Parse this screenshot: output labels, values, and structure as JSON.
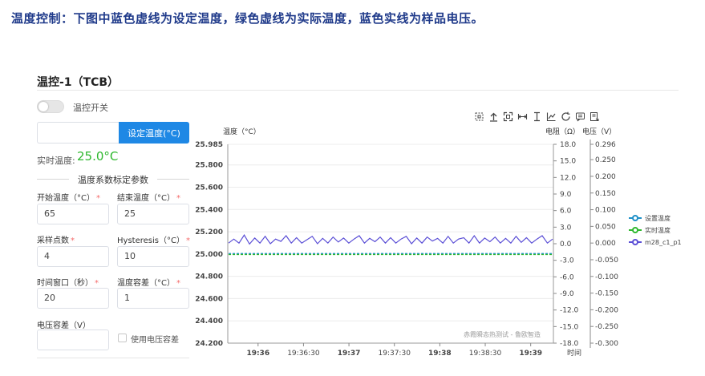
{
  "caption": "温度控制：下图中蓝色虚线为设定温度，绿色虚线为实际温度，蓝色实线为样品电压。",
  "panel": {
    "title": "温控-1（TCB）",
    "switch_label": "温控开关",
    "switch_on": false,
    "setpoint": {
      "value": "",
      "button_label": "设定温度(°C)"
    },
    "realtime": {
      "label": "实时温度:",
      "value": "25.0°C",
      "color": "#2eb82e"
    },
    "section_title": "温度系数标定参数",
    "fields": [
      {
        "key": "start_temp",
        "label": "开始温度（°C）",
        "required": true,
        "value": "65"
      },
      {
        "key": "end_temp",
        "label": "结束温度（°C）",
        "required": true,
        "value": "25"
      },
      {
        "key": "sample_points",
        "label": "采样点数",
        "required": true,
        "value": "4"
      },
      {
        "key": "hysteresis",
        "label": "Hysteresis（°C）",
        "required": true,
        "value": "10"
      },
      {
        "key": "time_window",
        "label": "时间窗口（秒）",
        "required": true,
        "value": "20"
      },
      {
        "key": "temp_tolerance",
        "label": "温度容差（°C）",
        "required": true,
        "value": "1"
      },
      {
        "key": "voltage_tolerance",
        "label": "电压容差（V）",
        "required": false,
        "value": ""
      }
    ],
    "use_voltage_tolerance": {
      "label": "使用电压容差",
      "checked": false
    }
  },
  "toolbar": [
    "zoom-select-icon",
    "upload-icon",
    "fullscreen-icon",
    "fit-width-icon",
    "fit-height-icon",
    "line-chart-icon",
    "reset-icon",
    "comment-icon",
    "export-icon"
  ],
  "colors": {
    "accent": "#1e88e5",
    "set_temp": "#1e90c8",
    "real_temp": "#2eb82e",
    "voltage": "#5b4fd6"
  },
  "chart_data": {
    "type": "line",
    "watermark": "赤霞瞬态热测试 - 鲁欧智造",
    "y_left": {
      "label": "温度（°C）",
      "range": [
        24.2,
        25.985
      ],
      "ticks": [
        25.985,
        25.8,
        25.6,
        25.4,
        25.2,
        25.0,
        24.8,
        24.6,
        24.4,
        24.2
      ],
      "tick_labels": [
        "25.985",
        "25.800",
        "25.600",
        "25.400",
        "25.200",
        "25.000",
        "24.800",
        "24.600",
        "24.400",
        "24.200"
      ]
    },
    "y_res": {
      "label": "电阻（Ω）",
      "range": [
        -18,
        18
      ],
      "ticks": [
        18,
        15,
        12,
        9,
        6,
        3,
        0,
        -3,
        -6,
        -9,
        -12,
        -15,
        -18
      ],
      "tick_labels": [
        "18.0",
        "15.0",
        "12.0",
        "9.0",
        "6.0",
        "3.0",
        "0.0",
        "-3.0",
        "-6.0",
        "-9.0",
        "-12.0",
        "-15.0",
        "-18.0"
      ]
    },
    "y_volt": {
      "label": "电压（V）",
      "range": [
        -0.3,
        0.296
      ],
      "ticks": [
        0.296,
        0.25,
        0.2,
        0.15,
        0.1,
        0.05,
        0.0,
        -0.05,
        -0.1,
        -0.15,
        -0.2,
        -0.25,
        -0.3
      ],
      "tick_labels": [
        "0.296",
        "0.250",
        "0.200",
        "0.150",
        "0.100",
        "0.050",
        "0.000",
        "-0.050",
        "-0.100",
        "-0.150",
        "-0.200",
        "-0.250",
        "-0.300"
      ]
    },
    "x": {
      "label": "时间",
      "range_seconds": [
        0,
        215
      ],
      "tick_labels": [
        "19:36",
        "19:36:30",
        "19:37",
        "19:37:30",
        "19:38",
        "19:38:30",
        "19:39"
      ],
      "tick_bold": [
        true,
        false,
        true,
        false,
        true,
        false,
        true
      ],
      "tick_seconds": [
        20,
        50,
        80,
        110,
        140,
        170,
        200
      ]
    },
    "series": [
      {
        "name": "设置温度",
        "axis": "temp",
        "style": "dashed",
        "color": "#1e90c8",
        "values": [
          25.0,
          25.0
        ]
      },
      {
        "name": "实时温度",
        "axis": "temp",
        "style": "dashed",
        "color": "#2eb82e",
        "values": [
          25.0,
          25.0
        ]
      },
      {
        "name": "m28_c1_p1",
        "axis": "volt",
        "style": "solid",
        "color": "#5b4fd6",
        "values": [
          0.0,
          0.012,
          0.0,
          0.024,
          -0.003,
          0.015,
          0.0,
          0.02,
          -0.002,
          0.012,
          0.005,
          0.022,
          0.0,
          0.016,
          0.0,
          0.01,
          0.02,
          -0.002,
          0.014,
          0.0,
          0.018,
          0.003,
          0.015,
          0.0,
          0.012,
          0.022,
          0.0,
          0.014,
          0.004,
          0.018,
          0.0,
          0.016,
          0.0,
          0.012,
          0.02,
          -0.002,
          0.015,
          0.0,
          0.018,
          0.006,
          0.014,
          0.0,
          0.02,
          0.0,
          0.012,
          0.016,
          0.0,
          0.022,
          0.0,
          0.015,
          0.004,
          0.018,
          0.0,
          0.014,
          0.0,
          0.02,
          0.002,
          0.016,
          0.0,
          0.012,
          0.022,
          0.0,
          0.012
        ]
      }
    ],
    "legend_position": "right"
  }
}
